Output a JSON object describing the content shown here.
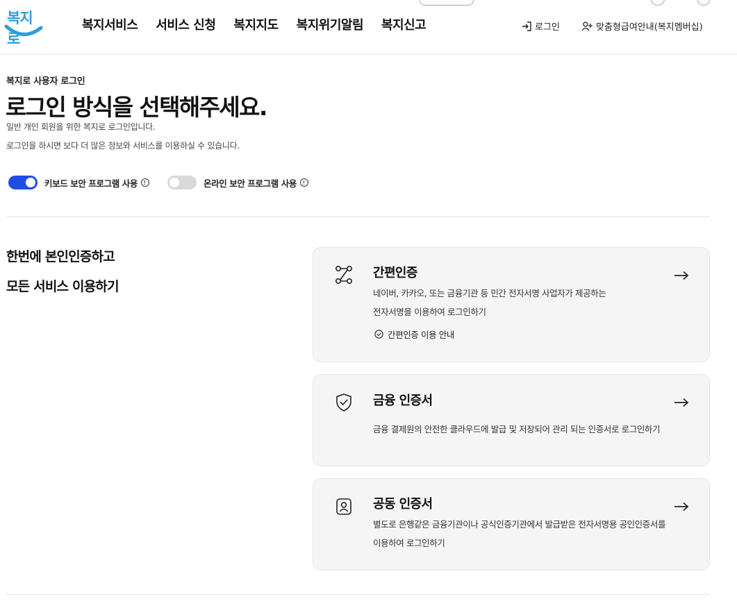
{
  "header": {
    "logo_text": "복지로",
    "nav": [
      "복지서비스",
      "서비스 신청",
      "복지지도",
      "복지위기알림",
      "복지신고"
    ],
    "login_label": "로그인",
    "membership_label": "맞춤형급여안내(복지멤버십)",
    "icons": {
      "login": "login-arrow-icon",
      "membership": "user-plus-icon"
    }
  },
  "intro": {
    "eyebrow": "복지로 사용자 로그인",
    "title": "로그인 방식을 선택해주세요.",
    "desc1": "일반 개인 회원을 위한 복지로 로그인입니다.",
    "desc2": "로그인을 하시면 보다 더 많은 정보와 서비스를 이용하실 수 있습니다."
  },
  "toggles": [
    {
      "label": "키보드 보안 프로그램 사용",
      "on": true
    },
    {
      "label": "온라인 보안 프로그램 사용",
      "on": false
    }
  ],
  "tagline": {
    "line1": "한번에 본인인증하고",
    "line2": "모든 서비스 이용하기"
  },
  "cards": {
    "easy": {
      "title": "간편인증",
      "desc1": "네이버, 카카오, 또는 금융기관 등 민간 전자서명 사업자가 제공하는",
      "desc2": "전자서명을 이용하여 로그인하기",
      "guide": "간편인증 이용 안내",
      "icon": "route-icon"
    },
    "financial": {
      "title": "금융 인증서",
      "desc1": "금융 결제원의 안전한 클라우드에 발급 및 저장되어 관리 되는 인증서로 로그인하기",
      "icon": "shield-check-icon"
    },
    "joint": {
      "title": "공동 인증서",
      "desc1": "별도로 은행같은 금융기관이나 공식인증기관에서 발급받은 전자서명용 공인인증서를",
      "desc2": "이용하여 로그인하기",
      "icon": "id-card-icon"
    }
  },
  "colors": {
    "toggle_on": "#1f4de4",
    "toggle_off": "#d9d9d9",
    "logo": "#2f9dd9",
    "card_bg": "#f5f5f5"
  }
}
